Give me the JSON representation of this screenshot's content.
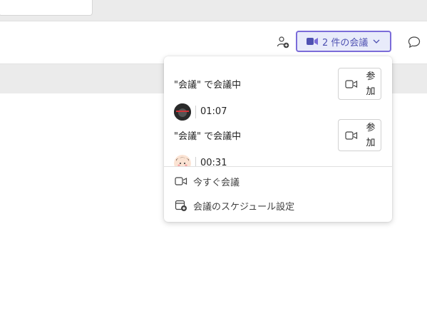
{
  "header": {
    "meetings_button_label": "2 件の会議",
    "colors": {
      "accent": "#4f52b2",
      "accent_border": "#7b6cd9",
      "accent_bg": "#e8ebfa"
    },
    "icons": [
      "people-add-icon",
      "video-icon",
      "chevron-down-icon",
      "chat-icon"
    ]
  },
  "popup": {
    "meetings": [
      {
        "title": "\"会議\" で会議中",
        "join_label": "参加",
        "duration": "01:07",
        "avatar": "dark-avatar"
      },
      {
        "title": "\"会議\" で会議中",
        "join_label": "参加",
        "duration": "00:31",
        "avatar": "cartoon-face-avatar"
      }
    ],
    "menu": [
      {
        "label": "今すぐ会議",
        "icon": "video-icon"
      },
      {
        "label": "会議のスケジュール設定",
        "icon": "calendar-add-icon"
      }
    ]
  }
}
